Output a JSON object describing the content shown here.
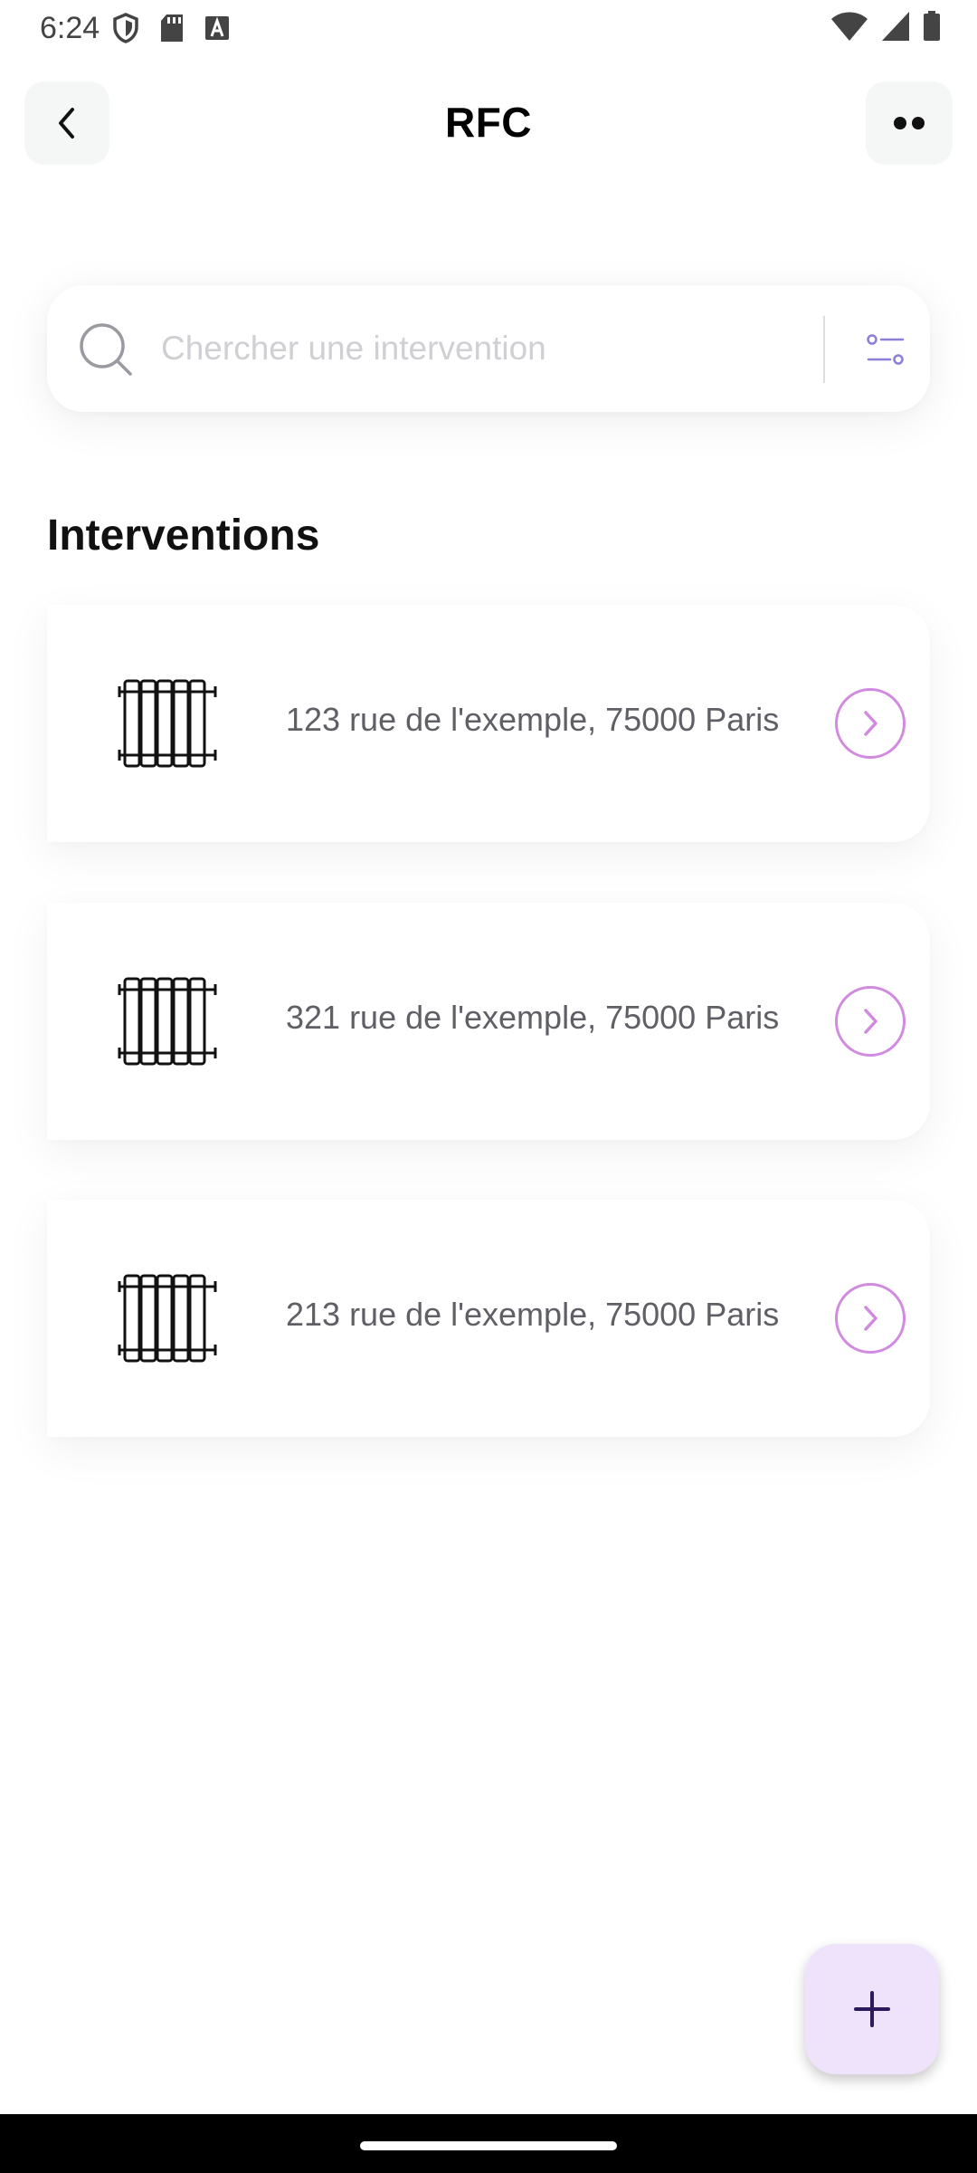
{
  "status_bar": {
    "time": "6:24",
    "left_icons": [
      "shield-icon",
      "sd-card-icon",
      "a-badge-icon"
    ],
    "right_icons": [
      "wifi-icon",
      "cell-signal-icon",
      "battery-icon"
    ]
  },
  "app_bar": {
    "title": "RFC",
    "back_icon": "chevron-left-icon",
    "more_icon": "more-dots-icon"
  },
  "search": {
    "placeholder": "Chercher une intervention",
    "value": "",
    "search_icon": "search-icon",
    "filter_icon": "filter-icon"
  },
  "section": {
    "title": "Interventions"
  },
  "interventions": [
    {
      "address": "123 rue de l'exemple, 75000 Paris",
      "icon": "radiator-icon"
    },
    {
      "address": "321 rue de l'exemple, 75000 Paris",
      "icon": "radiator-icon"
    },
    {
      "address": "213 rue de l'exemple, 75000 Paris",
      "icon": "radiator-icon"
    }
  ],
  "fab": {
    "icon": "plus-icon"
  },
  "colors": {
    "accent": "#d28ae0",
    "filter_icon": "#8b7fd8",
    "fab_bg": "#efe3fb",
    "fab_icon": "#2a1a5e",
    "button_bg": "#f5f6f6"
  }
}
